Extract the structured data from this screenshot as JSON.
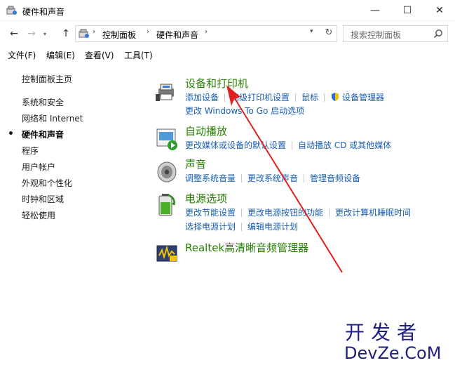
{
  "window": {
    "title": "硬件和声音",
    "minimize": "—",
    "maximize": "☐",
    "close": "✕"
  },
  "addressbar": {
    "back": "←",
    "forward": "→",
    "up": "↑",
    "separator": "›",
    "breadcrumb": [
      "控制面板",
      "硬件和声音"
    ],
    "refresh": "↻",
    "search_placeholder": "搜索控制面板"
  },
  "menu": [
    "文件(F)",
    "编辑(E)",
    "查看(V)",
    "工具(T)"
  ],
  "sidebar": {
    "home": "控制面板主页",
    "items": [
      "系统和安全",
      "网络和 Internet",
      "硬件和声音",
      "程序",
      "用户帐户",
      "外观和个性化",
      "时钟和区域",
      "轻松使用"
    ],
    "active_index": 2
  },
  "categories": {
    "devices": {
      "title": "设备和打印机",
      "links_row1": [
        "添加设备",
        "高级打印机设置",
        "鼠标",
        "设备管理器"
      ],
      "links_row2": [
        "更改 Windows To Go 启动选项"
      ]
    },
    "autoplay": {
      "title": "自动播放",
      "links_row1": [
        "更改媒体或设备的默认设置",
        "自动播放 CD 或其他媒体"
      ]
    },
    "sound": {
      "title": "声音",
      "links_row1": [
        "调整系统音量",
        "更改系统声音",
        "管理音频设备"
      ]
    },
    "power": {
      "title": "电源选项",
      "links_row1": [
        "更改节能设置",
        "更改电源按钮的功能",
        "更改计算机睡眠时间"
      ],
      "links_row2": [
        "选择电源计划",
        "编辑电源计划"
      ]
    },
    "realtek": {
      "title": "Realtek高清晰音频管理器"
    }
  },
  "watermark": {
    "line1": "开发者",
    "line2": "DevZe.CoM"
  },
  "colors": {
    "heading_green": "#267f00",
    "link_blue": "#1a5fb4",
    "arrow_red": "#e0201e",
    "watermark": "#1f1f80"
  }
}
